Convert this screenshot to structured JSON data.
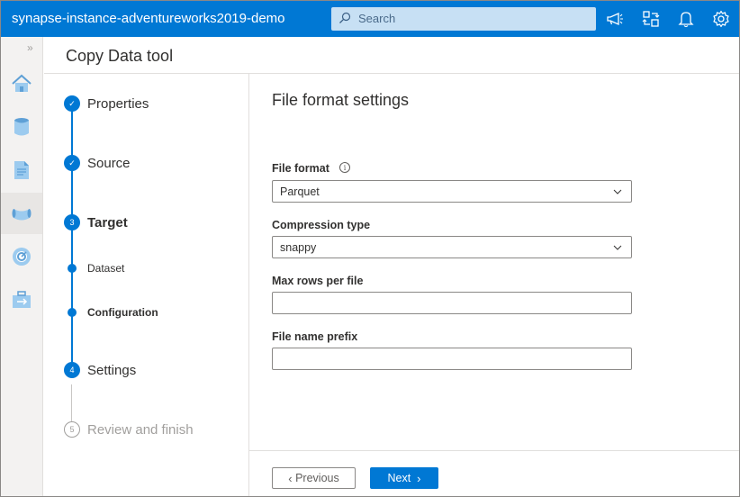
{
  "app": {
    "title": "synapse-instance-adventureworks2019-demo"
  },
  "search": {
    "placeholder": "Search",
    "icon": "search-icon"
  },
  "topbar_icons": [
    "announcement-icon",
    "directory-switch-icon",
    "notifications-icon",
    "settings-icon"
  ],
  "rail": {
    "toggle": "»",
    "items": [
      {
        "name": "home-icon"
      },
      {
        "name": "data-icon"
      },
      {
        "name": "develop-icon"
      },
      {
        "name": "integrate-icon"
      },
      {
        "name": "monitor-icon"
      },
      {
        "name": "manage-icon"
      }
    ]
  },
  "page": {
    "title": "Copy Data tool"
  },
  "steps": [
    {
      "label": "Properties",
      "status": "done",
      "marker": "✓"
    },
    {
      "label": "Source",
      "status": "done",
      "marker": "✓"
    },
    {
      "label": "Target",
      "status": "current",
      "marker": "3"
    },
    {
      "label": "Settings",
      "status": "upcoming",
      "marker": "4"
    },
    {
      "label": "Review and finish",
      "status": "disabled",
      "marker": "5"
    }
  ],
  "substeps": [
    {
      "label": "Dataset",
      "active": false
    },
    {
      "label": "Configuration",
      "active": true
    }
  ],
  "form": {
    "section_title": "File format settings",
    "file_format": {
      "label": "File format",
      "value": "Parquet"
    },
    "compression_type": {
      "label": "Compression type",
      "value": "snappy"
    },
    "max_rows": {
      "label": "Max rows per file",
      "value": ""
    },
    "file_name_prefix": {
      "label": "File name prefix",
      "value": ""
    }
  },
  "footer": {
    "previous_label": "Previous",
    "next_label": "Next"
  },
  "colors": {
    "accent": "#0078d4",
    "search_bg": "#c7e0f4",
    "rail_bg": "#f3f2f1"
  }
}
